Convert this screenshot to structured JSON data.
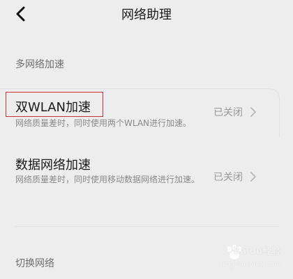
{
  "header": {
    "title": "网络助理"
  },
  "sections": {
    "multi_network_title": "多网络加速",
    "switch_network_title": "切换网络"
  },
  "rows": [
    {
      "title": "双WLAN加速",
      "description": "网络质量差时，同时使用两个WLAN进行加速。",
      "status": "已关闭"
    },
    {
      "title": "数据网络加速",
      "description": "网络质量差时，同时使用移动数据网络进行加速。",
      "status": "已关闭"
    }
  ],
  "watermark": {
    "brand": "Baidu经验",
    "url": "jingyan.baidu.com"
  },
  "colors": {
    "background": "#ededed",
    "title_text": "#1a1a1a",
    "secondary_text": "#8a8a8a",
    "highlight_border": "#c8313b"
  },
  "icons": {
    "back": "back-chevron-icon",
    "row_chevron": "chevron-right-icon"
  }
}
